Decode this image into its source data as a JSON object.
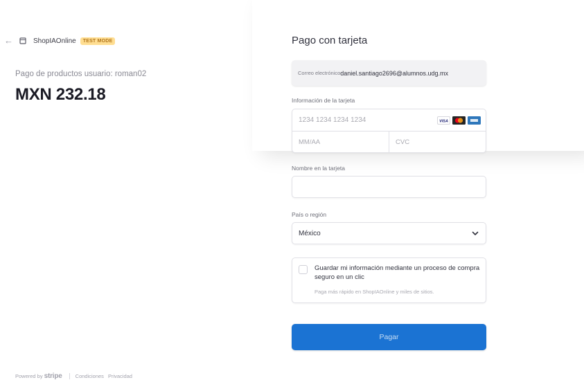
{
  "header": {
    "store_name": "ShopIAOnline",
    "badge": "TEST MODE"
  },
  "summary": {
    "description": "Pago de productos usuario: roman02",
    "amount": "MXN 232.18"
  },
  "footer": {
    "powered_by": "Powered by",
    "brand": "stripe",
    "links": [
      "Condiciones",
      "Privacidad"
    ]
  },
  "form": {
    "title": "Pago con tarjeta",
    "email_label": "Correo electrónico",
    "email_value": "daniel.santiago2696@alumnos.udg.mx",
    "card_label": "Información de la tarjeta",
    "card_number_placeholder": "1234 1234 1234 1234",
    "expiry_placeholder": "MM/AA",
    "cvc_placeholder": "CVC",
    "card_brands": [
      "visa-icon",
      "mastercard-icon",
      "amex-icon"
    ],
    "name_label": "Nombre en la tarjeta",
    "name_value": "",
    "country_label": "País o región",
    "country_value": "México",
    "save_title": "Guardar mi información mediante un proceso de compra seguro en un clic",
    "save_subtitle": "Paga más rápido en ShopIAOnline y miles de sitios.",
    "save_checked": false,
    "pay_label": "Pagar"
  },
  "colors": {
    "accent": "#1b73d3",
    "badge_bg": "#ffde92",
    "badge_text": "#b3771e"
  }
}
